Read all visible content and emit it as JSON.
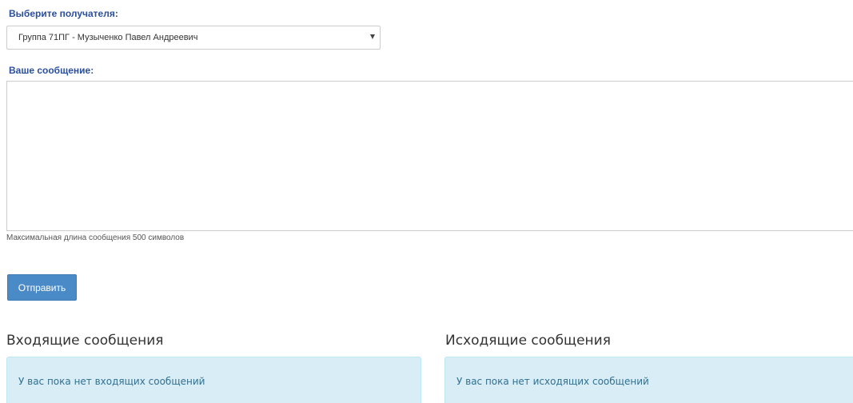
{
  "form": {
    "recipient_label": "Выберите получателя:",
    "recipient_selected": "Группа 71ПГ - Музыченко Павел Андреевич",
    "message_label": "Ваше сообщение:",
    "message_value": "",
    "help_text": "Максимальная длина сообщения 500 символов",
    "send_label": "Отправить"
  },
  "incoming": {
    "title": "Входящие сообщения",
    "empty_text": "У вас пока нет входящих сообщений"
  },
  "outgoing": {
    "title": "Исходящие сообщения",
    "empty_text": "У вас пока нет исходящих сообщений"
  },
  "colors": {
    "label": "#2a4f9c",
    "button": "#4a8ac6",
    "info_bg": "#d9edf7",
    "info_text": "#31708f"
  },
  "icons": {
    "select_arrow": "caret-down-icon"
  }
}
